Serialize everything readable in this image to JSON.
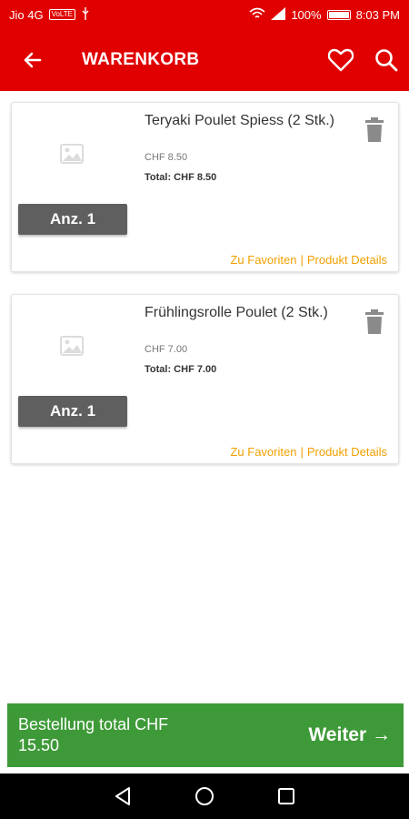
{
  "status_bar": {
    "carrier": "Jio 4G",
    "volte": "VoLTE",
    "battery": "100%",
    "time": "8:03 PM"
  },
  "toolbar": {
    "title": "WARENKORB"
  },
  "cart_items": [
    {
      "name": "Teryaki Poulet Spiess (2 Stk.)",
      "price": "CHF 8.50",
      "total": "Total: CHF 8.50",
      "quantity": "Anz. 1",
      "favorite_link": "Zu Favoriten",
      "separator": "|",
      "details_link": "Produkt Details"
    },
    {
      "name": "Frühlingsrolle Poulet (2 Stk.)",
      "price": "CHF 7.00",
      "total": "Total: CHF 7.00",
      "quantity": "Anz. 1",
      "favorite_link": "Zu Favoriten",
      "separator": "|",
      "details_link": "Produkt Details"
    }
  ],
  "checkout": {
    "total_label": "Bestellung total CHF 15.50",
    "continue_label": "Weiter →"
  },
  "colors": {
    "brand_red": "#e00000",
    "checkout_green": "#3e9a38",
    "link_orange": "#f0a000",
    "quantity_gray": "#5f5f5f"
  }
}
